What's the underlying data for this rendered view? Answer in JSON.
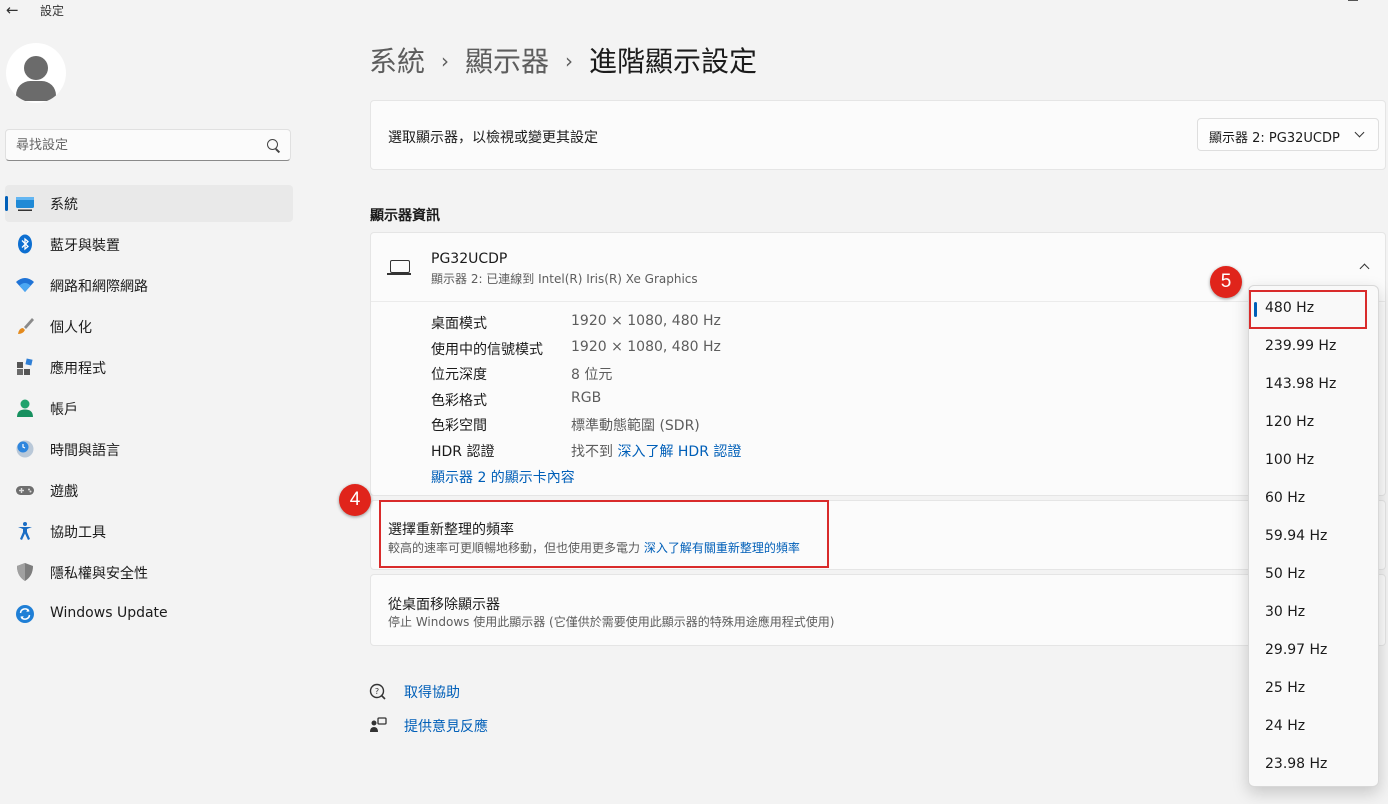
{
  "window": {
    "title": "設定"
  },
  "sidebar": {
    "search_placeholder": "尋找設定",
    "items": [
      {
        "label": "系統",
        "icon": "display-icon",
        "active": true
      },
      {
        "label": "藍牙與裝置",
        "icon": "bluetooth-icon"
      },
      {
        "label": "網路和網際網路",
        "icon": "wifi-icon"
      },
      {
        "label": "個人化",
        "icon": "brush-icon"
      },
      {
        "label": "應用程式",
        "icon": "apps-icon"
      },
      {
        "label": "帳戶",
        "icon": "account-icon"
      },
      {
        "label": "時間與語言",
        "icon": "clock-globe-icon"
      },
      {
        "label": "遊戲",
        "icon": "gamepad-icon"
      },
      {
        "label": "協助工具",
        "icon": "accessibility-icon"
      },
      {
        "label": "隱私權與安全性",
        "icon": "shield-icon"
      },
      {
        "label": "Windows Update",
        "icon": "update-icon"
      }
    ]
  },
  "breadcrumb": {
    "items": [
      "系統",
      "顯示器",
      "進階顯示設定"
    ],
    "separator": "›"
  },
  "select_display": {
    "label": "選取顯示器，以檢視或變更其設定",
    "value": "顯示器 2: PG32UCDP"
  },
  "display_info": {
    "section_label": "顯示器資訊",
    "name": "PG32UCDP",
    "subtitle": "顯示器 2: 已連線到 Intel(R) Iris(R) Xe Graphics",
    "rows": [
      {
        "key": "桌面模式",
        "value": "1920 × 1080, 480 Hz"
      },
      {
        "key": "使用中的信號模式",
        "value": "1920 × 1080, 480 Hz"
      },
      {
        "key": "位元深度",
        "value": "8 位元"
      },
      {
        "key": "色彩格式",
        "value": "RGB"
      },
      {
        "key": "色彩空間",
        "value": "標準動態範圍 (SDR)"
      }
    ],
    "hdr": {
      "key": "HDR 認證",
      "value": "找不到",
      "link": "深入了解 HDR 認證"
    },
    "adapter_link": "顯示器 2 的顯示卡內容"
  },
  "refresh_rate": {
    "title": "選擇重新整理的頻率",
    "subtitle": "較高的速率可更順暢地移動，但也使用更多電力",
    "link": "深入了解有關重新整理的頻率",
    "selected": "480 Hz",
    "options": [
      "480 Hz",
      "239.99 Hz",
      "143.98 Hz",
      "120 Hz",
      "100 Hz",
      "60 Hz",
      "59.94 Hz",
      "50 Hz",
      "30 Hz",
      "29.97 Hz",
      "25 Hz",
      "24 Hz",
      "23.98 Hz"
    ]
  },
  "remove_display": {
    "title": "從桌面移除顯示器",
    "subtitle": "停止 Windows 使用此顯示器 (它僅供於需要使用此顯示器的特殊用途應用程式使用)"
  },
  "footer": {
    "help": "取得協助",
    "feedback": "提供意見反應"
  },
  "annotations": {
    "step4": "4",
    "step5": "5",
    "highlight_color": "#d92b2b"
  },
  "colors": {
    "accent": "#005fb8",
    "background": "#f3f3f3"
  }
}
